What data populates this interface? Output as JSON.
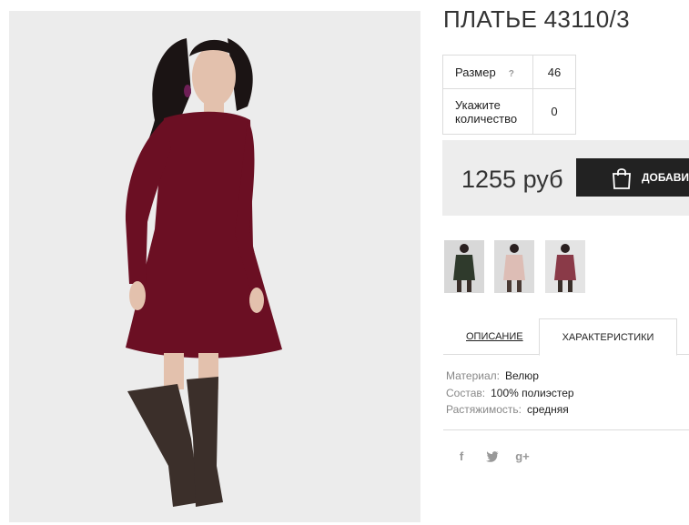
{
  "product": {
    "title": "ПЛАТЬЕ 43110/3",
    "image_alt": "Model in burgundy velour long-sleeve dress and brown over-the-knee boots"
  },
  "options": [
    {
      "label": "Размер",
      "help_icon": "?",
      "value": "46"
    },
    {
      "label": "Укажите количество",
      "value": "0"
    }
  ],
  "buy": {
    "price": "1255 руб",
    "button_label": "ДОБАВИТЬ В КОРЗИНУ",
    "button_icon": "shopping-bag-icon"
  },
  "thumbnails": [
    {
      "name": "thumbnail-green"
    },
    {
      "name": "thumbnail-pink"
    },
    {
      "name": "thumbnail-burgundy"
    }
  ],
  "tabs": {
    "description": "ОПИСАНИЕ",
    "characteristics": "ХАРАКТЕРИСТИКИ",
    "active": "characteristics"
  },
  "characteristics": [
    {
      "key": "Материал:",
      "value": "Велюр"
    },
    {
      "key": "Состав:",
      "value": "100% полиэстер"
    },
    {
      "key": "Растяжимость:",
      "value": "средняя"
    }
  ],
  "social": {
    "facebook": "f",
    "twitter": "twitter-icon",
    "google_plus": "g+"
  },
  "colors": {
    "dress": "#6b0f23",
    "button_bg": "#222222",
    "buybox_bg": "#ededed",
    "border": "#dcdcdc"
  }
}
